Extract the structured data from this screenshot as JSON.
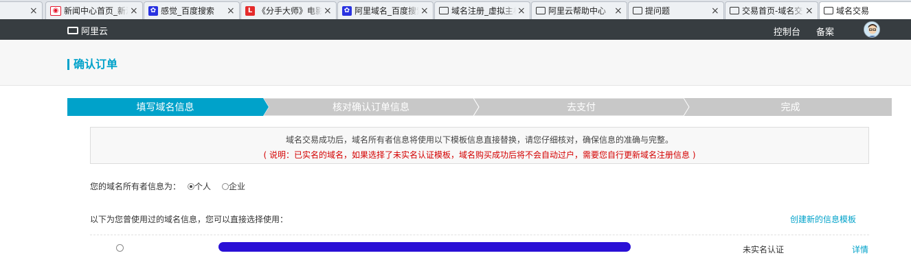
{
  "tabs": [
    {
      "label": "",
      "icon": "none",
      "close": "×"
    },
    {
      "label": "新闻中心首页_新浪网",
      "icon": "weibo-icon",
      "close": "×"
    },
    {
      "label": "感觉_百度搜索",
      "icon": "baidu-icon",
      "close": "×"
    },
    {
      "label": "《分手大师》电影",
      "icon": "l-red-icon",
      "close": "×"
    },
    {
      "label": "阿里域名_百度搜索",
      "icon": "baidu-icon",
      "close": "×"
    },
    {
      "label": "域名注册_虚拟主机",
      "icon": "aliyun-icon",
      "close": "×"
    },
    {
      "label": "阿里云帮助中心",
      "icon": "aliyun-icon",
      "close": "×"
    },
    {
      "label": "提问题",
      "icon": "aliyun-icon",
      "close": "×"
    },
    {
      "label": "交易首页-域名交易",
      "icon": "aliyun-icon",
      "close": "×"
    },
    {
      "label": "域名交易",
      "icon": "aliyun-icon",
      "close": ""
    }
  ],
  "nav": {
    "logo_text": "阿里云",
    "console": "控制台",
    "beian": "备案"
  },
  "page": {
    "title": "确认订单"
  },
  "steps": [
    {
      "label": "填写域名信息",
      "state": "active"
    },
    {
      "label": "核对确认订单信息",
      "state": "inactive"
    },
    {
      "label": "去支付",
      "state": "inactive"
    },
    {
      "label": "完成",
      "state": "inactive"
    }
  ],
  "notice": {
    "line1": "域名交易成功后，域名所有者信息将使用以下模板信息直接替换，请您仔细核对，确保信息的准确与完整。",
    "line2": "( 说明：已实名的域名，如果选择了未实名认证模板，域名购买成功后将不会自动过户，需要您自行更新域名注册信息 )"
  },
  "owner": {
    "label": "您的域名所有者信息为：",
    "options": [
      {
        "label": "个人",
        "checked": true
      },
      {
        "label": "企业",
        "checked": false
      }
    ]
  },
  "history": {
    "label": "以下为您曾使用过的域名信息，您可以直接选择使用：",
    "create_link": "创建新的信息模板"
  },
  "record": {
    "status": "未实名认证",
    "detail": "详情"
  },
  "colors": {
    "accent": "#00a2ca",
    "nav_bg": "#373d41",
    "step_active": "#00a2ca",
    "step_inactive": "#c8c8c8",
    "warning": "#d40000",
    "redaction": "#2a10d6"
  }
}
